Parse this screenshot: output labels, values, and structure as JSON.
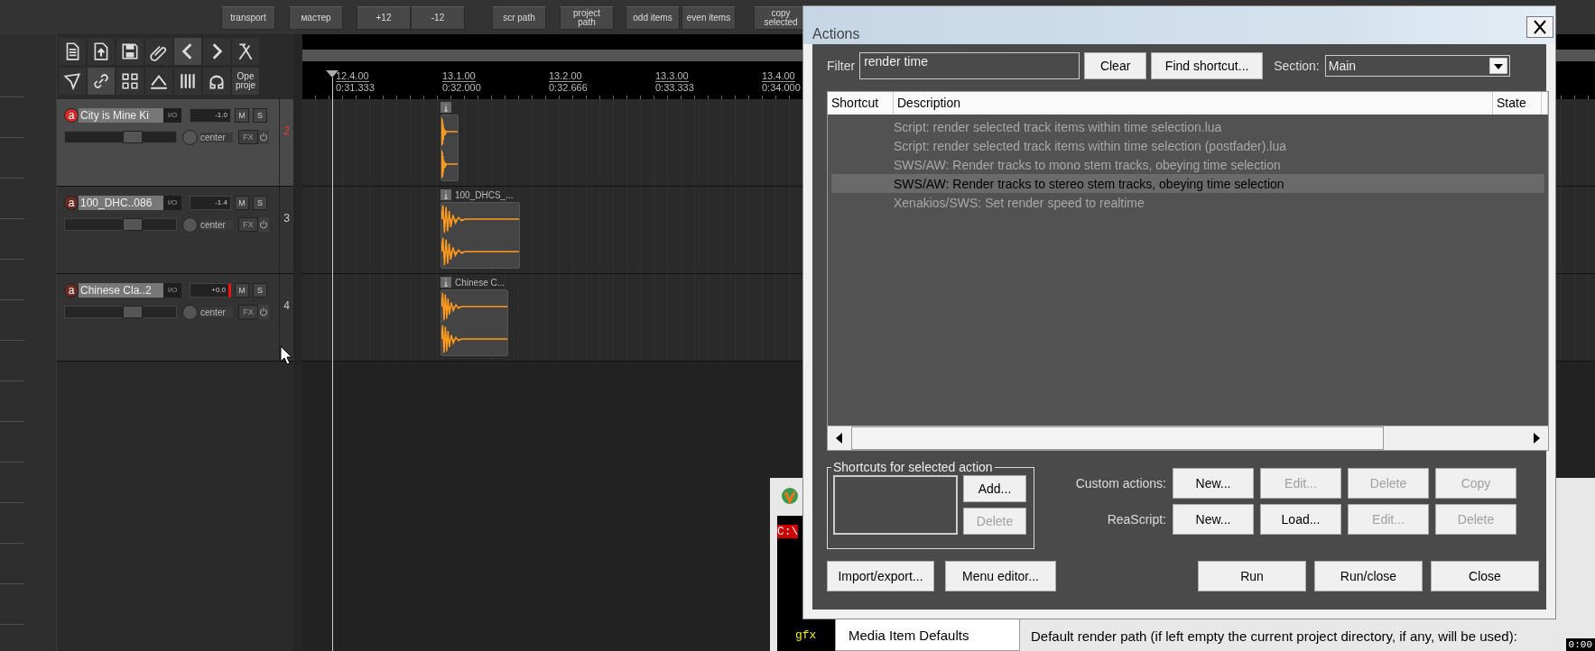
{
  "toolbar": {
    "buttons": [
      {
        "label": "transport"
      },
      {
        "label": "мастер"
      },
      {
        "label": "+12"
      },
      {
        "label": "-12"
      },
      {
        "label": "scr path"
      },
      {
        "label": "project path"
      },
      {
        "label": "odd items"
      },
      {
        "label": "even items"
      },
      {
        "label": "copy selected"
      }
    ]
  },
  "track_toolbar": {
    "open_label": "Ope proje"
  },
  "ruler": {
    "marks": [
      {
        "bar": "12.4.00",
        "time": "0:31.333"
      },
      {
        "bar": "13.1.00",
        "time": "0:32.000"
      },
      {
        "bar": "13.2.00",
        "time": "0:32.666"
      },
      {
        "bar": "13.3.00",
        "time": "0:33.333"
      },
      {
        "bar": "13.4.00",
        "time": "0:34.000"
      }
    ]
  },
  "tracks": [
    {
      "record_label": "a",
      "name": "City is Mine Ki",
      "io": "I/O",
      "volume": "-1.0",
      "clipping": false,
      "mute": "M",
      "solo": "S",
      "pan": "center",
      "fx": "FX",
      "number": "2",
      "selected": true,
      "armed": true,
      "level": 0.64
    },
    {
      "record_label": "a",
      "name": "100_DHC..086",
      "io": "I/O",
      "volume": "-1.4",
      "clipping": false,
      "mute": "M",
      "solo": "S",
      "pan": "center",
      "fx": "FX",
      "number": "3",
      "selected": false,
      "armed": false,
      "level": 0.64,
      "item_label": "100_DHCS_..."
    },
    {
      "record_label": "a",
      "name": "Chinese Cla..2",
      "io": "I/O",
      "volume": "+0.0",
      "clipping": true,
      "mute": "M",
      "solo": "S",
      "pan": "center",
      "fx": "FX",
      "number": "4",
      "selected": false,
      "armed": false,
      "level": 0.64,
      "item_label": "Chinese C..."
    }
  ],
  "actions_dialog": {
    "title": "Actions",
    "filter_label": "Filter",
    "filter_value": "render time",
    "clear_button": "Clear",
    "find_button": "Find shortcut...",
    "section_label": "Section:",
    "section_value": "Main",
    "columns": [
      "Shortcut",
      "Description",
      "State"
    ],
    "rows": [
      {
        "description": "Script: render selected track items within time selection.lua",
        "selected": false
      },
      {
        "description": "Script: render selected track items within time selection (postfader).lua",
        "selected": false
      },
      {
        "description": "SWS/AW: Render tracks to mono stem tracks, obeying time selection",
        "selected": false
      },
      {
        "description": "SWS/AW: Render tracks to stereo stem tracks, obeying time selection",
        "selected": true
      },
      {
        "description": "Xenakios/SWS: Set render speed to realtime",
        "selected": false
      }
    ],
    "shortcuts_group": {
      "title": "Shortcuts for selected action",
      "buttons": [
        {
          "label": "Add...",
          "disabled": false
        },
        {
          "label": "Delete",
          "disabled": true
        }
      ]
    },
    "button_rows": [
      {
        "label": "Custom actions:",
        "buttons": [
          {
            "label": "New...",
            "disabled": false
          },
          {
            "label": "Edit...",
            "disabled": true
          },
          {
            "label": "Delete",
            "disabled": true
          },
          {
            "label": "Copy",
            "disabled": true
          }
        ]
      },
      {
        "label": "ReaScript:",
        "buttons": [
          {
            "label": "New...",
            "disabled": false
          },
          {
            "label": "Load...",
            "disabled": false
          },
          {
            "label": "Edit...",
            "disabled": true
          },
          {
            "label": "Delete",
            "disabled": true
          }
        ]
      }
    ],
    "left_buttons": [
      "Import/export...",
      "Menu editor..."
    ],
    "right_buttons": [
      "Run",
      "Run/close",
      "Close"
    ]
  },
  "background_window": {
    "console_lines": [
      {
        "text": "C:\\",
        "kind": "path"
      },
      {
        "text": "gfx",
        "kind": "output"
      }
    ],
    "sidebar_items": [
      "Media Item Defaults"
    ],
    "render_path_label": "Default render path (if left empty the current project directory, if any, will be used):",
    "clock": "0:00"
  }
}
